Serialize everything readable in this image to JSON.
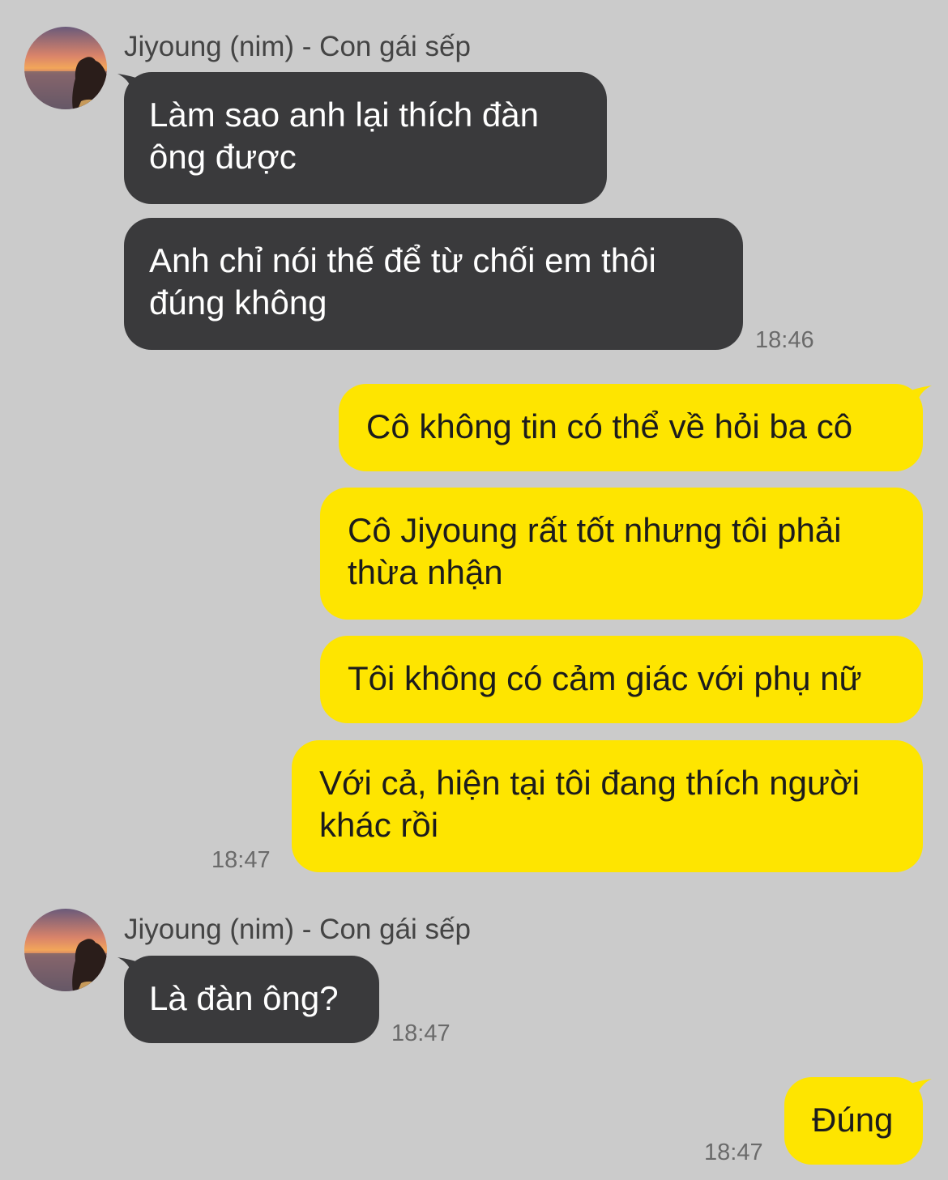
{
  "colors": {
    "background": "#cbcbcb",
    "incoming_bubble": "#3a3a3c",
    "outgoing_bubble": "#fee500"
  },
  "contact": {
    "name": "Jiyoung (nim) - Con gái sếp",
    "avatar_icon": "sunset-silhouette-avatar"
  },
  "messages": {
    "m1": "Làm sao anh lại thích đàn\nông được",
    "m2": "Anh chỉ nói thế để từ chối em thôi\nđúng không",
    "m3": "Cô không tin có thể về hỏi ba cô",
    "m4": "Cô Jiyoung rất tốt nhưng tôi phải\nthừa nhận",
    "m5": "Tôi không có cảm giác với phụ nữ",
    "m6": "Với cả, hiện tại tôi đang thích người\nkhác rồi",
    "m7": "Là đàn ông?",
    "m8": "Đúng"
  },
  "times": {
    "t1": "18:46",
    "t2": "18:47",
    "t3": "18:47",
    "t4": "18:47"
  }
}
